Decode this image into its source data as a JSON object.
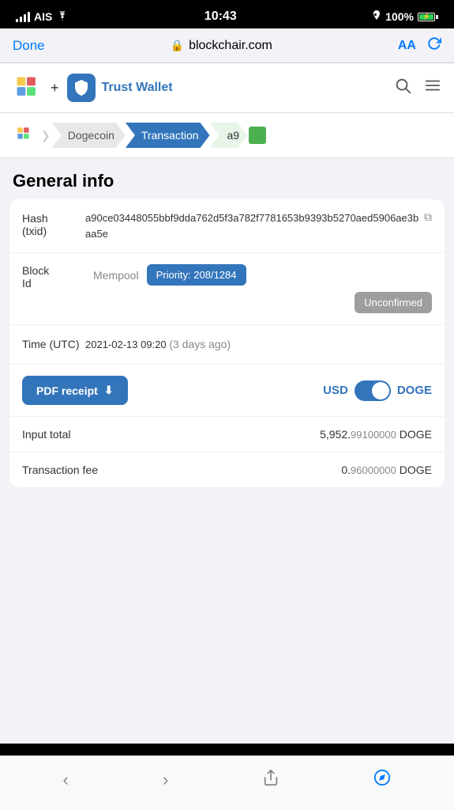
{
  "statusBar": {
    "carrier": "AIS",
    "time": "10:43",
    "battery": "100%",
    "signal": true,
    "wifi": true
  },
  "browserBar": {
    "doneLabel": "Done",
    "url": "blockchair.com",
    "aaLabel": "AA",
    "lockIcon": "🔒"
  },
  "header": {
    "plusLabel": "+",
    "trustWalletLabel": "Trust Wallet",
    "searchIcon": "search",
    "menuIcon": "menu"
  },
  "breadcrumb": {
    "dogecoinLabel": "Dogecoin",
    "transactionLabel": "Transaction",
    "shortLabel": "a9"
  },
  "generalInfo": {
    "sectionTitle": "General info",
    "hashLabel": "Hash\n(txid)",
    "hashValue": "a90ce03448055bbf9dda762d5f3a782f7781653b9393b5270aed5906ae3baa5e",
    "blockLabel": "Block\nId",
    "mempoolText": "Mempool",
    "priorityLabel": "Priority: 208/1284",
    "unconfirmedLabel": "Unconfirmed",
    "timeLabel": "Time (UTC)",
    "timeValue": "2021-02-13",
    "timeHour": "09:20",
    "timeRelative": "(3 days ago)",
    "pdfReceiptLabel": "PDF receipt",
    "downloadIcon": "⬇",
    "currencyUSD": "USD",
    "currencyDOGE": "DOGE",
    "inputTotalLabel": "Input total",
    "inputTotalMain": "5,952.",
    "inputTotalDecimal": "99100000",
    "inputTotalCurrency": "DOGE",
    "txFeeLabel": "Transaction fee",
    "txFeeMain": "0.",
    "txFeeDecimal": "96000000",
    "txFeeCurrency": "DOGE"
  },
  "bottomNav": {
    "backLabel": "‹",
    "forwardLabel": "›",
    "shareIcon": "share",
    "compassIcon": "compass"
  }
}
